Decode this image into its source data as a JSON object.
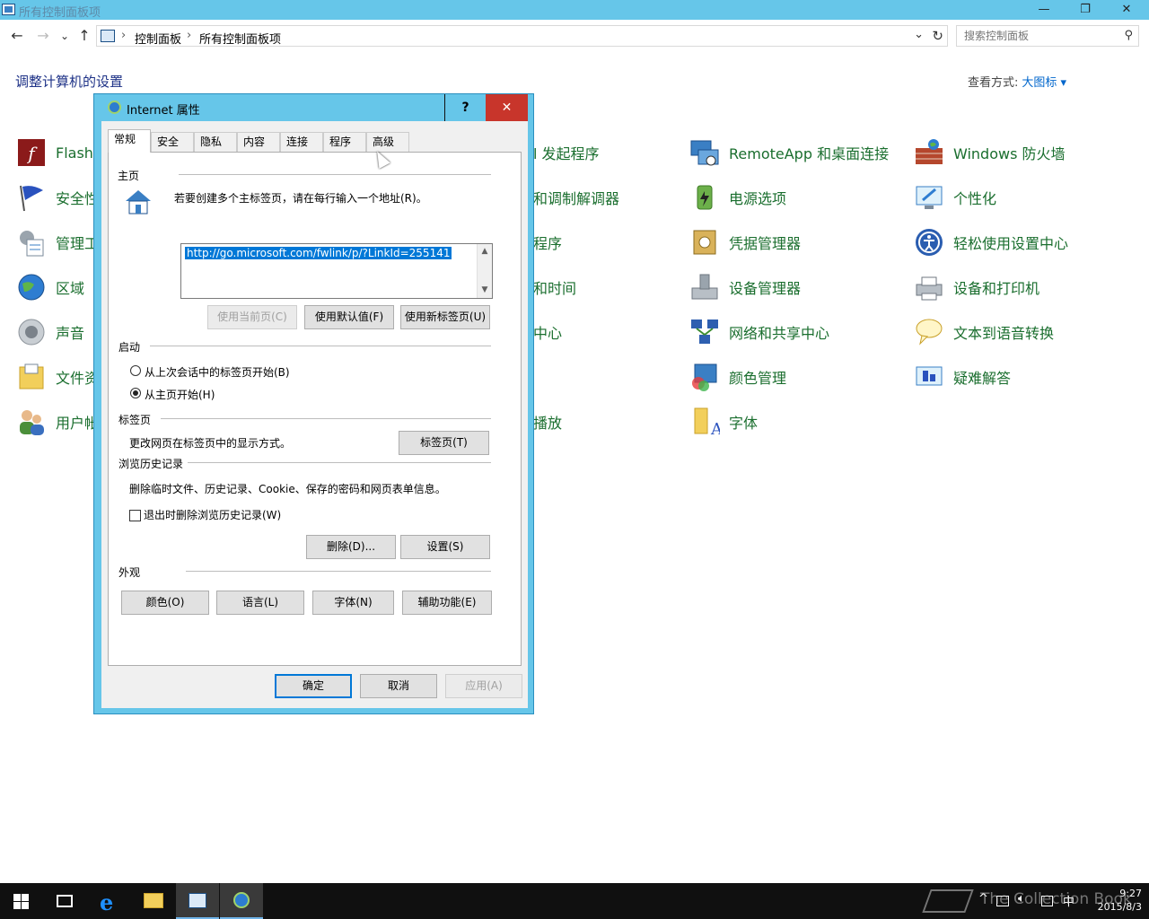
{
  "window": {
    "title": "所有控制面板项",
    "min_glyph": "—",
    "max_glyph": "❐",
    "close_glyph": "✕"
  },
  "nav": {
    "back": "←",
    "forward": "→",
    "recent": "⌄",
    "up": "↑"
  },
  "address": {
    "crumbs": [
      "控制面板",
      "所有控制面板项"
    ],
    "separator": "›",
    "dropdown": "⌄",
    "refresh": "↻"
  },
  "search": {
    "placeholder": "搜索控制面板",
    "icon": "⚲"
  },
  "heading": "调整计算机的设置",
  "view_mode": {
    "label": "查看方式:",
    "value": "大图标 ▾"
  },
  "items": {
    "col1": [
      "Flash",
      "安全性",
      "管理工",
      "区域",
      "声音",
      "文件资",
      "用户帐"
    ],
    "col2": [
      "l 发起程序",
      "和调制解调器",
      "程序",
      "和时间",
      "中心",
      "",
      "播放"
    ],
    "col3": [
      "RemoteApp 和桌面连接",
      "电源选项",
      "凭据管理器",
      "设备管理器",
      "网络和共享中心",
      "颜色管理",
      "字体"
    ],
    "col4": [
      "Windows 防火墙",
      "个性化",
      "轻松使用设置中心",
      "设备和打印机",
      "文本到语音转换",
      "疑难解答"
    ]
  },
  "dialog": {
    "title": "Internet 属性",
    "help": "?",
    "close": "✕",
    "tabs": [
      "常规",
      "安全",
      "隐私",
      "内容",
      "连接",
      "程序",
      "高级"
    ],
    "homepage": {
      "group": "主页",
      "instruction": "若要创建多个主标签页，请在每行输入一个地址(R)。",
      "url": "http://go.microsoft.com/fwlink/p/?LinkId=255141",
      "use_current": "使用当前页(C)",
      "use_default": "使用默认值(F)",
      "use_new_tab": "使用新标签页(U)"
    },
    "startup": {
      "group": "启动",
      "option_last": "从上次会话中的标签页开始(B)",
      "option_home": "从主页开始(H)"
    },
    "tabs_group": {
      "group": "标签页",
      "desc": "更改网页在标签页中的显示方式。",
      "button": "标签页(T)"
    },
    "history": {
      "group": "浏览历史记录",
      "desc": "删除临时文件、历史记录、Cookie、保存的密码和网页表单信息。",
      "delete_on_exit": "退出时删除浏览历史记录(W)",
      "delete_btn": "删除(D)...",
      "settings_btn": "设置(S)"
    },
    "appearance": {
      "group": "外观",
      "colors": "颜色(O)",
      "languages": "语言(L)",
      "fonts": "字体(N)",
      "accessibility": "辅助功能(E)"
    },
    "ok": "确定",
    "cancel": "取消",
    "apply": "应用(A)"
  },
  "taskbar": {
    "tray_chevron": "^",
    "ime": "中",
    "time": "9:27",
    "date": "2015/8/3"
  },
  "watermark": "The Collection Book",
  "colors": {
    "titlebar": "#66c6e9",
    "link_green": "#1a6e2e",
    "heading_blue": "#1e3287",
    "close_red": "#c8352b",
    "selection": "#0078d7"
  }
}
